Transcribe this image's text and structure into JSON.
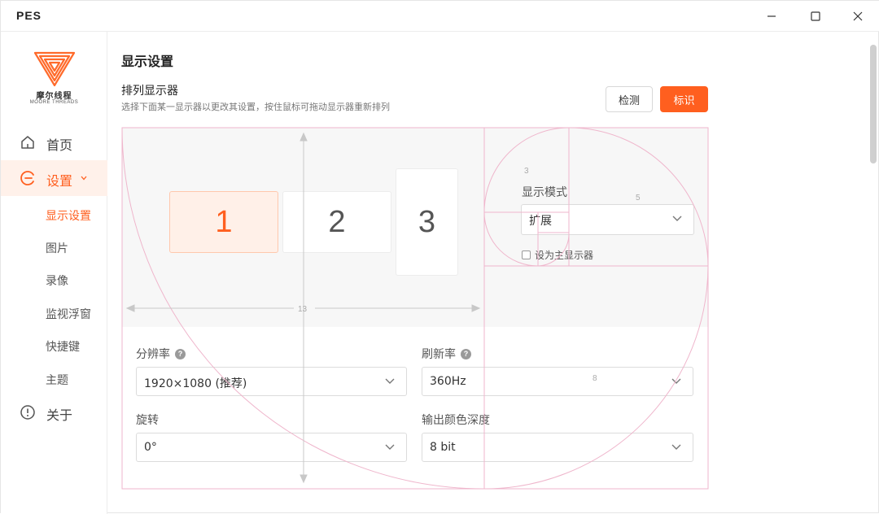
{
  "app": {
    "name": "PES"
  },
  "window_controls": {
    "minimize": "minimize",
    "maximize": "maximize",
    "close": "close"
  },
  "sidebar": {
    "logo": {
      "cn": "摩尔线程",
      "en": "MOORE THREADS"
    },
    "items": [
      {
        "label": "首页",
        "icon": "home-icon"
      },
      {
        "label": "设置",
        "icon": "settings-icon",
        "active": true
      },
      {
        "label": "关于",
        "icon": "info-icon"
      }
    ],
    "sub_items": [
      {
        "label": "显示设置",
        "active": true
      },
      {
        "label": "图片"
      },
      {
        "label": "录像"
      },
      {
        "label": "监视浮窗"
      },
      {
        "label": "快捷键"
      },
      {
        "label": "主题"
      }
    ]
  },
  "main": {
    "title": "显示设置",
    "arrange": {
      "title": "排列显示器",
      "desc": "选择下面某一显示器以更改其设置，按住鼠标可拖动显示器重新排列",
      "detect_label": "检测",
      "identify_label": "标识",
      "monitors": [
        "1",
        "2",
        "3"
      ]
    },
    "display_mode": {
      "label": "显示模式",
      "value": "扩展",
      "primary_label": "设为主显示器"
    },
    "resolution": {
      "label": "分辨率",
      "value": "1920×1080 (推荐)"
    },
    "refresh": {
      "label": "刷新率",
      "value": "360Hz"
    },
    "rotation": {
      "label": "旋转",
      "value": "0°"
    },
    "color_depth": {
      "label": "输出颜色深度",
      "value": "8 bit"
    }
  },
  "overlay_labels": {
    "n3": "3",
    "n5": "5",
    "n8": "8",
    "n13": "13"
  },
  "colors": {
    "accent": "#ff5f1f",
    "accent_light": "#fff1ea",
    "overlay": "#e8a0c0"
  }
}
